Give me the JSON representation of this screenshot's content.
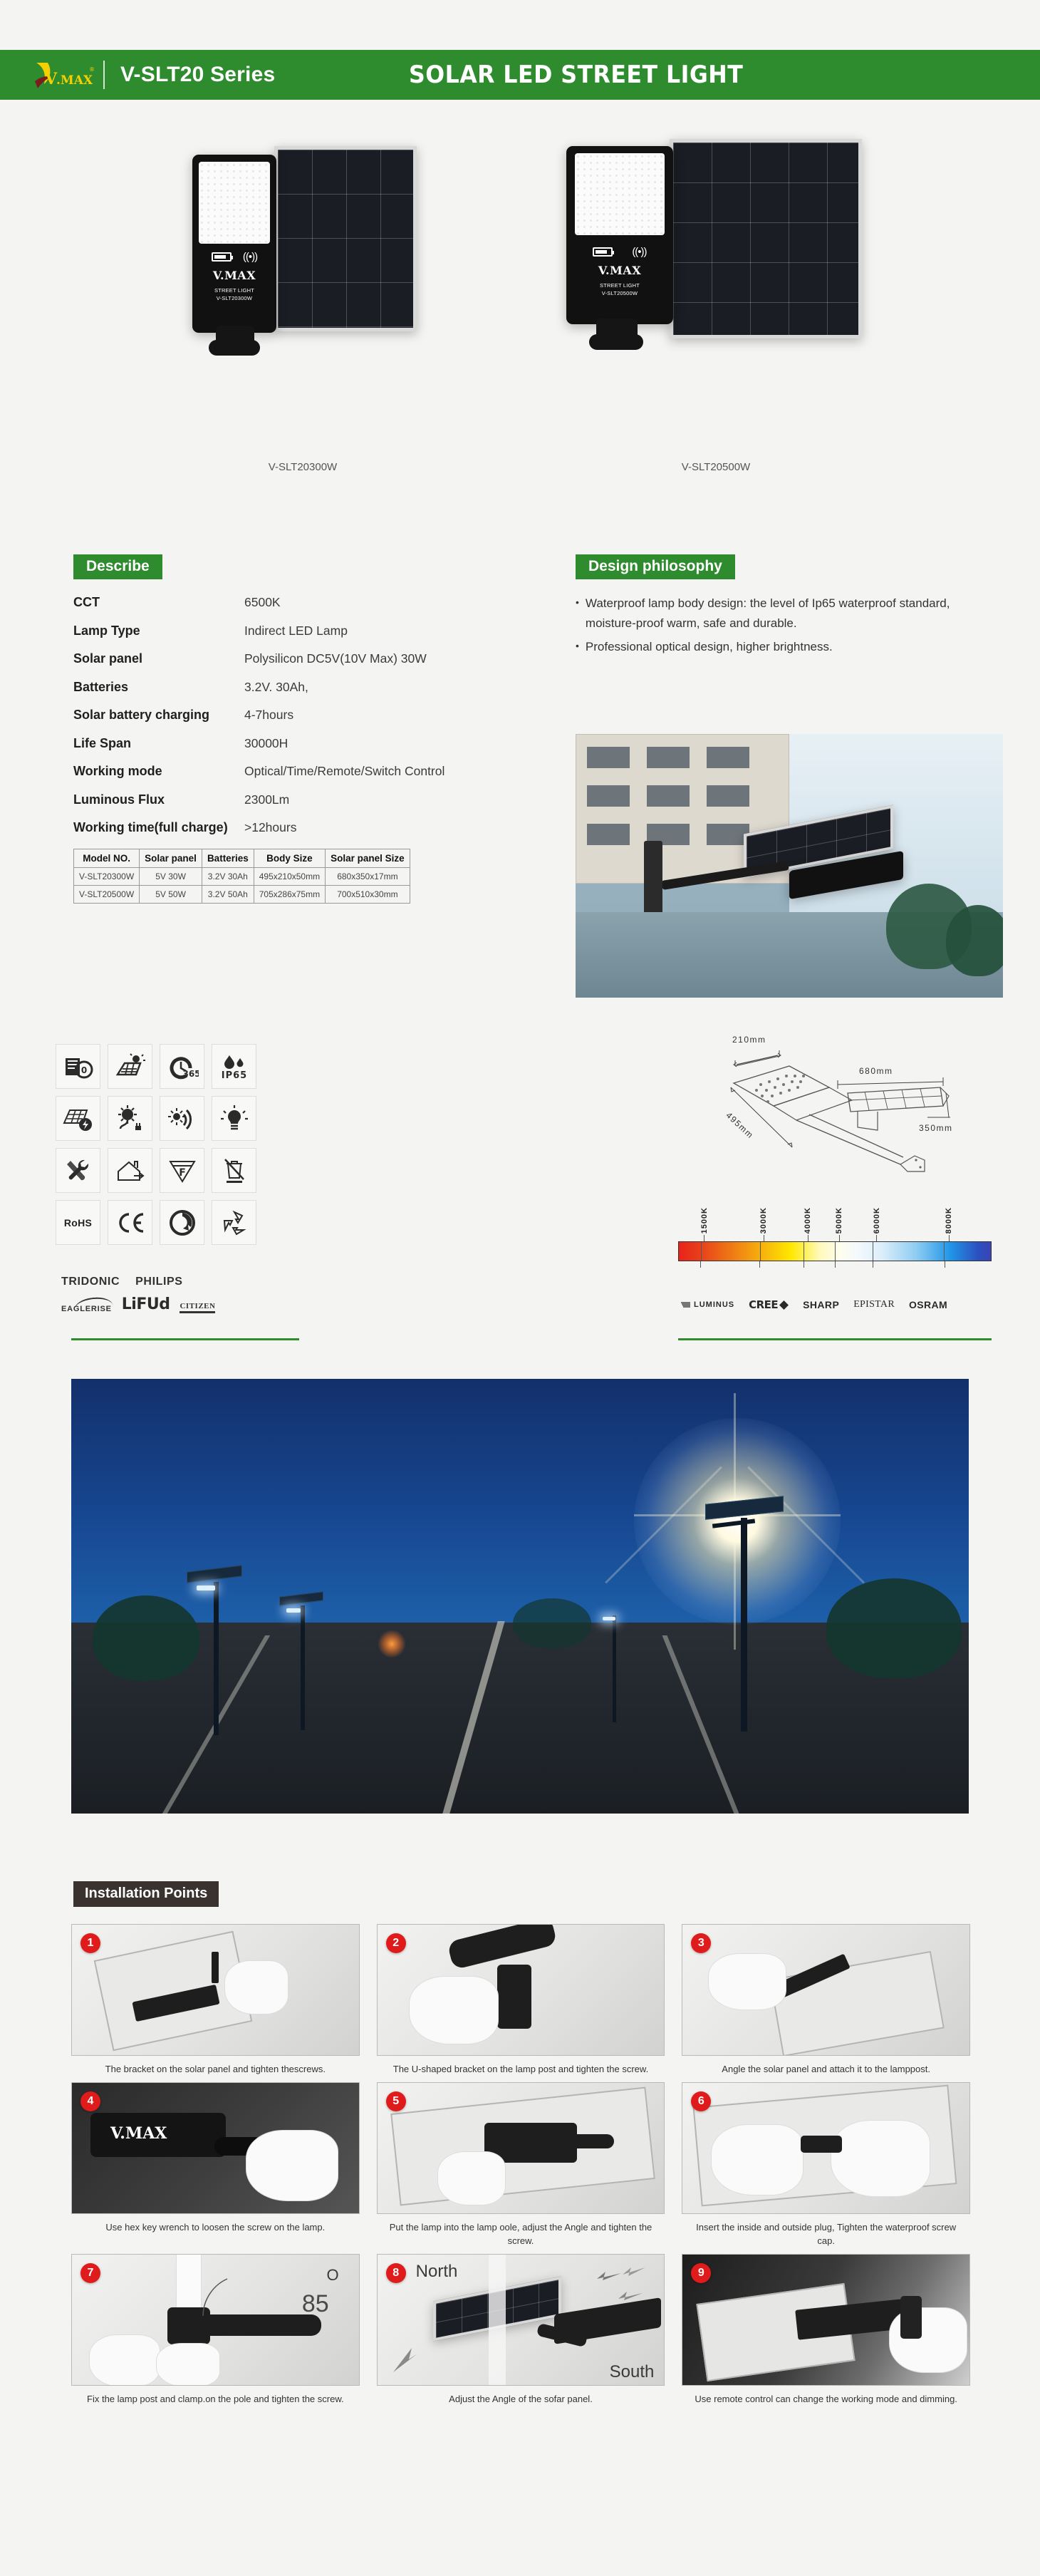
{
  "header": {
    "logo_text": "V.MAX",
    "series": "V-SLT20 Series",
    "title": "SOLAR LED STREET LIGHT",
    "brand_color": "#2e8b2e"
  },
  "hero": {
    "products": [
      {
        "caption": "V-SLT20300W",
        "brand": "V.MAX",
        "line1": "STREET LIGHT",
        "line2": "V-SLT20300W"
      },
      {
        "caption": "V-SLT20500W",
        "brand": "V.MAX",
        "line1": "STREET LIGHT",
        "line2": "V-SLT20500W"
      }
    ]
  },
  "describe": {
    "heading": "Describe",
    "specs": [
      {
        "key": "CCT",
        "value": "6500K"
      },
      {
        "key": "Lamp Type",
        "value": "Indirect LED Lamp"
      },
      {
        "key": "Solar panel",
        "value": "Polysilicon DC5V(10V Max) 30W"
      },
      {
        "key": "Batteries",
        "value": "3.2V. 30Ah,"
      },
      {
        "key": "Solar battery charging",
        "value": "4-7hours"
      },
      {
        "key": "Life Span",
        "value": "30000H"
      },
      {
        "key": "Working mode",
        "value": "Optical/Time/Remote/Switch Control"
      },
      {
        "key": "Luminous Flux",
        "value": "2300Lm"
      },
      {
        "key": "Working time(full charge)",
        "value": ">12hours"
      }
    ],
    "table": {
      "headers": [
        "Model NO.",
        "Solar panel",
        "Batteries",
        "Body Size",
        "Solar panel Size"
      ],
      "rows": [
        [
          "V-SLT20300W",
          "5V 30W",
          "3.2V 30Ah",
          "495x210x50mm",
          "680x350x17mm"
        ],
        [
          "V-SLT20500W",
          "5V 50W",
          "3.2V 50Ah",
          "705x286x75mm",
          "700x510x30mm"
        ]
      ]
    }
  },
  "philosophy": {
    "heading": "Design philosophy",
    "bullets": [
      "Waterproof lamp body design: the level of Ip65 waterproof standard, moisture-proof warm, safe and durable.",
      "Professional optical design, higher brightness."
    ]
  },
  "icon_grid": {
    "cells": [
      {
        "name": "zero-maintenance-icon",
        "label": "0"
      },
      {
        "name": "solar-charging-icon",
        "label": ""
      },
      {
        "name": "365-days-icon",
        "label": "365"
      },
      {
        "name": "ip65-icon",
        "label": "IP65"
      },
      {
        "name": "solar-panel-power-icon",
        "label": ""
      },
      {
        "name": "sun-plug-icon",
        "label": ""
      },
      {
        "name": "light-sensor-icon",
        "label": ""
      },
      {
        "name": "led-bulb-icon",
        "label": ""
      },
      {
        "name": "easy-install-tools-icon",
        "label": ""
      },
      {
        "name": "outdoor-house-icon",
        "label": ""
      },
      {
        "name": "energy-class-f-icon",
        "label": "F"
      },
      {
        "name": "weee-bin-icon",
        "label": ""
      },
      {
        "name": "rohs-icon",
        "label": "RoHS"
      },
      {
        "name": "ce-icon",
        "label": "CE"
      },
      {
        "name": "green-dot-icon",
        "label": ""
      },
      {
        "name": "recycle-icon",
        "label": ""
      }
    ]
  },
  "driver_brands": {
    "row1": [
      "TRIDONIC",
      "PHILIPS"
    ],
    "row2": [
      "EAGLERISE",
      "LiFUd",
      "CITIZEN"
    ]
  },
  "dimensions": {
    "labels": [
      {
        "text": "210mm"
      },
      {
        "text": "495mm"
      },
      {
        "text": "680mm"
      },
      {
        "text": "350mm"
      }
    ]
  },
  "cct_scale": {
    "ticks": [
      "1500K",
      "3000K",
      "4000K",
      "5000K",
      "6000K",
      "8000K"
    ],
    "positions": [
      7,
      26,
      40,
      50,
      62,
      85
    ]
  },
  "led_brands": [
    "LUMINUS",
    "CREE",
    "SHARP",
    "EPISTAR",
    "OSRAM"
  ],
  "installation": {
    "heading": "Installation Points",
    "steps": [
      {
        "num": "1",
        "caption": "The bracket on the solar panel and tighten thescrews."
      },
      {
        "num": "2",
        "caption": "The U-shaped bracket on the lamp post and tighten the screw."
      },
      {
        "num": "3",
        "caption": "Angle the solar panel and attach it to the lamppost."
      },
      {
        "num": "4",
        "caption": "Use hex key wrench to loosen the screw on the lamp."
      },
      {
        "num": "5",
        "caption": "Put the lamp into the lamp oole, adjust the Angle and tighten the screw."
      },
      {
        "num": "6",
        "caption": "Insert the inside and outside plug, Tighten the waterproof screw cap."
      },
      {
        "num": "7",
        "caption": "Fix the lamp post and clamp.on the pole and tighten the screw.",
        "angle": "85",
        "degree": "O"
      },
      {
        "num": "8",
        "caption": "Adjust the Angle of the sofar panel.",
        "north": "North",
        "south": "South"
      },
      {
        "num": "9",
        "caption": "Use remote control can change the working mode and dimming."
      }
    ]
  }
}
